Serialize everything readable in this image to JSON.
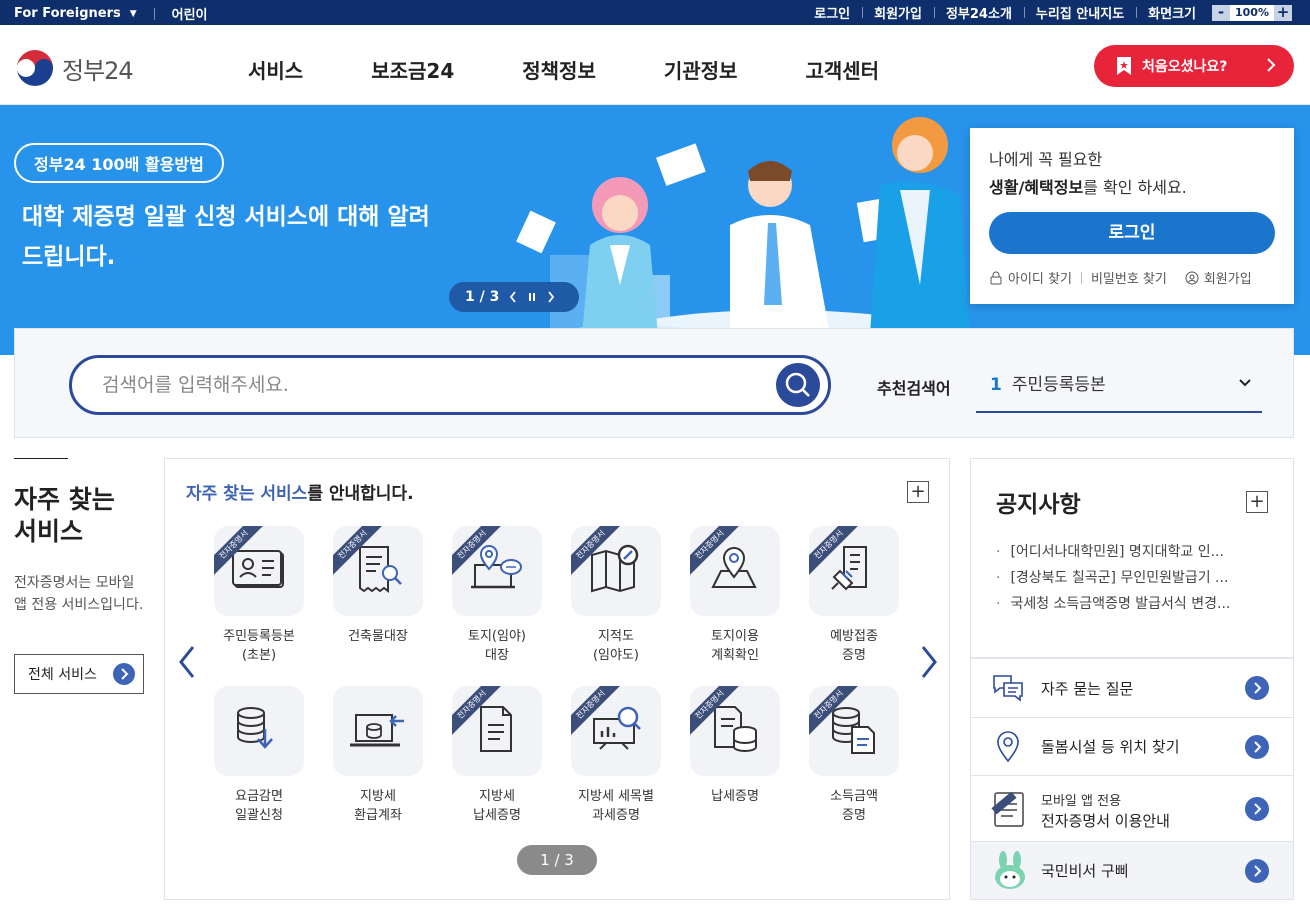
{
  "util_bar": {
    "foreigners": "For Foreigners",
    "kids": "어린이",
    "links": [
      "로그인",
      "회원가입",
      "정부24소개",
      "누리집 안내지도"
    ],
    "zoom_label": "화면크기",
    "zoom_value": "100%"
  },
  "header": {
    "logo_text": "정부24",
    "nav": [
      "서비스",
      "보조금24",
      "정책정보",
      "기관정보",
      "고객센터"
    ],
    "first_visit": "처음오셨나요?"
  },
  "banner": {
    "pill": "정부24 100배 활용방법",
    "title": "대학 제증명 일괄 신청 서비스에 대해 알려드립니다.",
    "counter": "1 / 3"
  },
  "login_box": {
    "line1": "나에게 꼭 필요한",
    "line2_bold": "생활/혜택정보",
    "line2_rest": "를 확인 하세요.",
    "button": "로그인",
    "find_id": "아이디 찾기",
    "find_pw": "비밀번호 찾기",
    "join": "회원가입"
  },
  "search": {
    "placeholder": "검색어를 입력해주세요.",
    "rec_label": "추천검색어",
    "rec_num": "1",
    "rec_value": "주민등록등본"
  },
  "left": {
    "title": "자주 찾는 서비스",
    "desc": "전자증명서는 모바일 앱 전용 서비스입니다.",
    "all_button": "전체 서비스"
  },
  "center": {
    "title_hl": "자주 찾는 서비스",
    "title_rest": "를 안내합니다.",
    "ribbon": "전자증명서",
    "services": [
      {
        "label": "주민등록등본\n(초본)",
        "ribbon": true,
        "icon": "id-card-icon"
      },
      {
        "label": "건축물대장",
        "ribbon": true,
        "icon": "document-search-icon"
      },
      {
        "label": "토지(임야)\n대장",
        "ribbon": true,
        "icon": "map-pin-laptop-icon"
      },
      {
        "label": "지적도\n(임야도)",
        "ribbon": true,
        "icon": "map-search-icon"
      },
      {
        "label": "토지이용\n계획확인",
        "ribbon": true,
        "icon": "location-map-icon"
      },
      {
        "label": "예방접종\n증명",
        "ribbon": true,
        "icon": "syringe-document-icon"
      },
      {
        "label": "요금감면\n일괄신청",
        "ribbon": false,
        "icon": "database-down-icon"
      },
      {
        "label": "지방세\n환급계좌",
        "ribbon": false,
        "icon": "laptop-refund-icon"
      },
      {
        "label": "지방세\n납세증명",
        "ribbon": true,
        "icon": "document-icon"
      },
      {
        "label": "지방세 세목별\n과세증명",
        "ribbon": true,
        "icon": "chart-board-icon"
      },
      {
        "label": "납세증명",
        "ribbon": true,
        "icon": "document-database-icon"
      },
      {
        "label": "소득금액\n증명",
        "ribbon": true,
        "icon": "database-document-icon"
      }
    ],
    "pager": "1 / 3"
  },
  "notice": {
    "title": "공지사항",
    "items": [
      "[어디서나대학민원] 명지대학교 인...",
      "[경상북도 칠곡군] 무인민원발급기 ...",
      "국세청 소득금액증명 발급서식 변경..."
    ]
  },
  "quick_links": [
    {
      "text": "자주 묻는 질문"
    },
    {
      "text": "돌봄시설 등 위치 찾기"
    },
    {
      "text_small": "모바일 앱 전용",
      "text": "전자증명서 이용안내"
    },
    {
      "text": "국민비서 구삐"
    }
  ],
  "colors": {
    "navy": "#0e2f6b",
    "banner": "#2893ea",
    "accent": "#2b4a99",
    "red": "#e8243b"
  }
}
